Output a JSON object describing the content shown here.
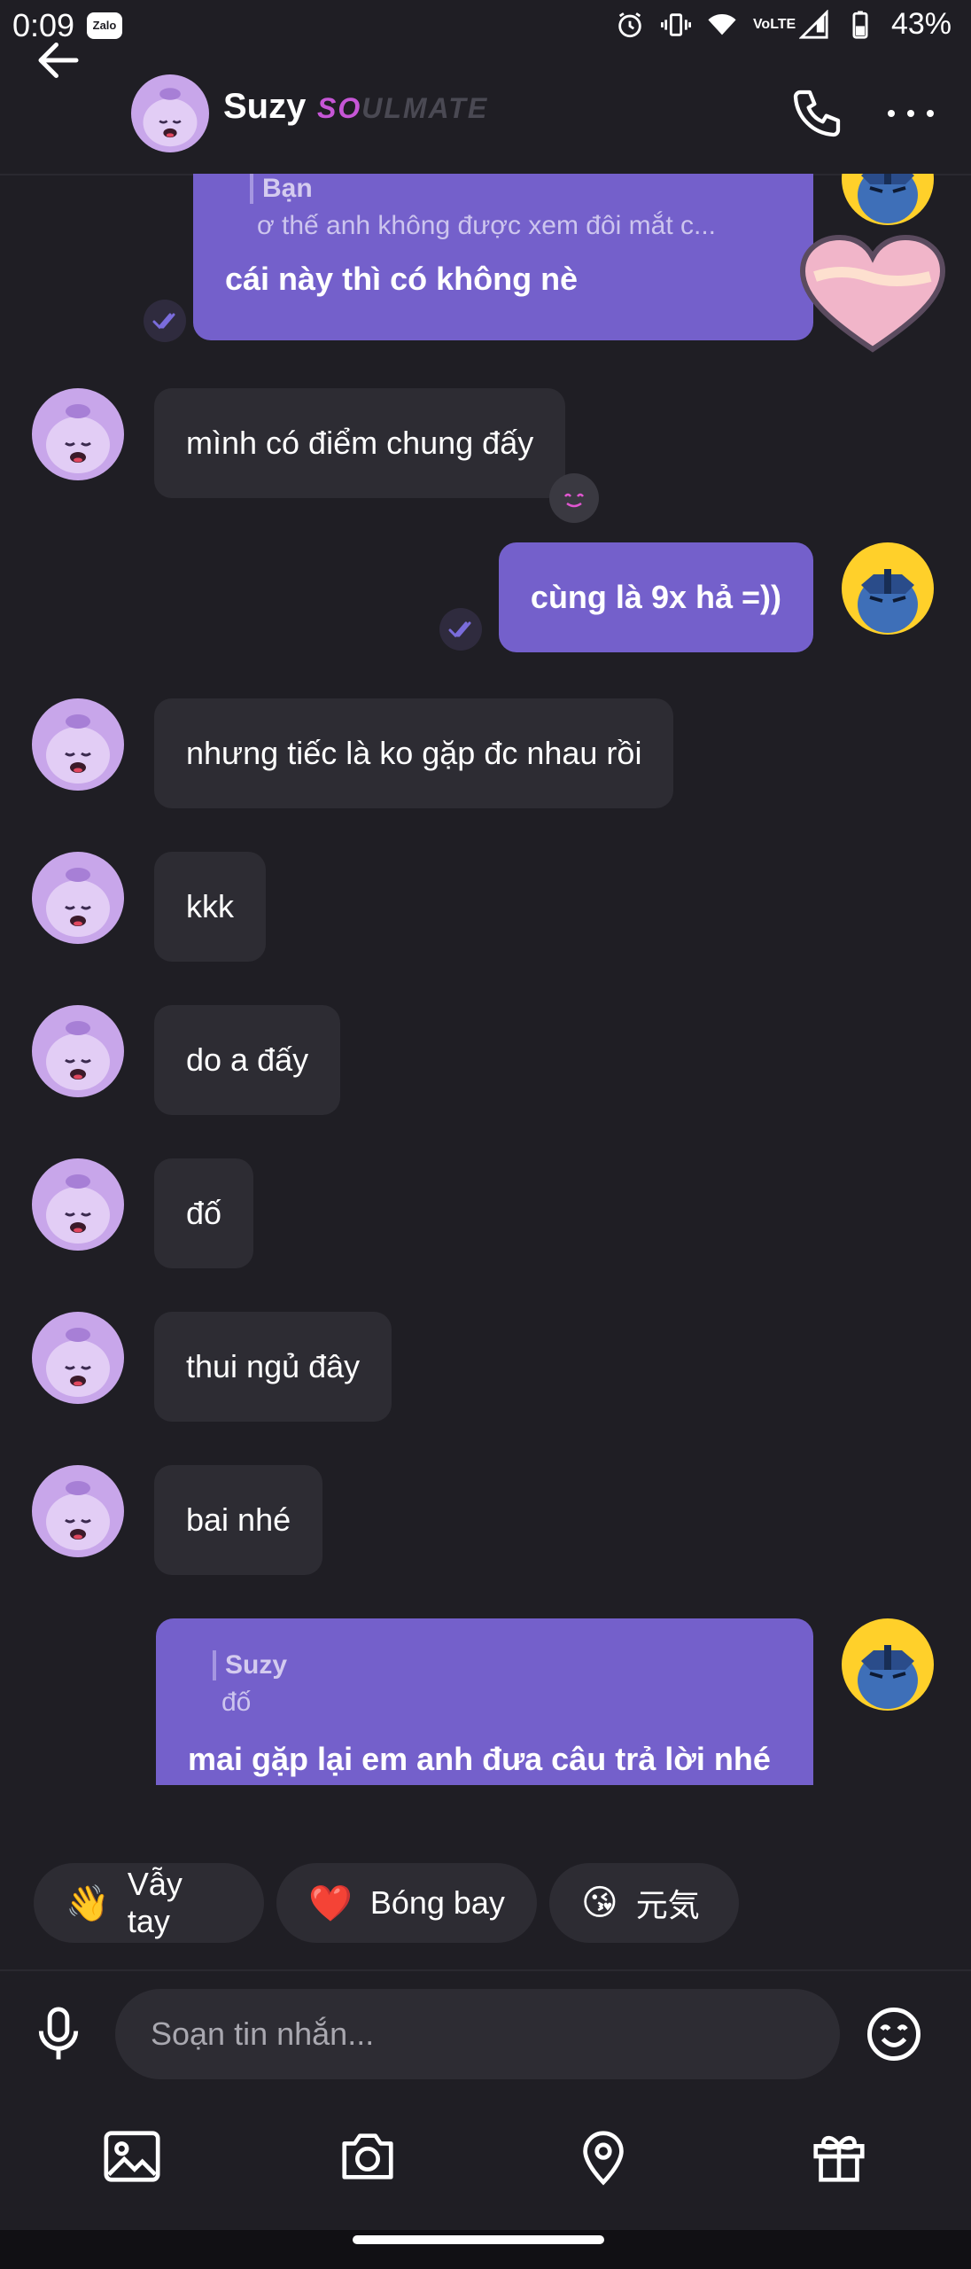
{
  "status_bar": {
    "time": "0:09",
    "app_badge": "Zalo",
    "network": "VoLTE",
    "battery": "43%"
  },
  "header": {
    "contact_name": "Suzy",
    "badge_part1": "SO",
    "badge_part2": "ULMATE"
  },
  "messages": {
    "m1_quote_name": "Bạn",
    "m1_quote_text": "ơ thế anh không được xem đôi mắt c...",
    "m1_text": "cái này thì có không nè",
    "m2_text": "mình có điểm chung đấy",
    "m3_text": "cùng là 9x hả =))",
    "m4_text": "nhưng tiếc là ko gặp đc nhau rồi",
    "m5_text": "kkk",
    "m6_text": "do a đấy",
    "m7_text": "đố",
    "m8_text": "thui ngủ đây",
    "m9_text": "bai nhé",
    "m10_quote_name": "Suzy",
    "m10_quote_text": "đố",
    "m10_text": "mai gặp lại em anh đưa câu trả lời nhé"
  },
  "quick_replies": [
    {
      "emoji": "👋",
      "label": "Vẫy tay"
    },
    {
      "emoji": "❤️",
      "label": "Bóng bay"
    },
    {
      "emoji": "😘",
      "label": "元気"
    }
  ],
  "composer": {
    "placeholder": "Soạn tin nhắn..."
  },
  "colors": {
    "background": "#1f1e24",
    "incoming_bubble": "#2d2c33",
    "outgoing_bubble": "#7460cb",
    "badge_accent": "#c656d6"
  }
}
